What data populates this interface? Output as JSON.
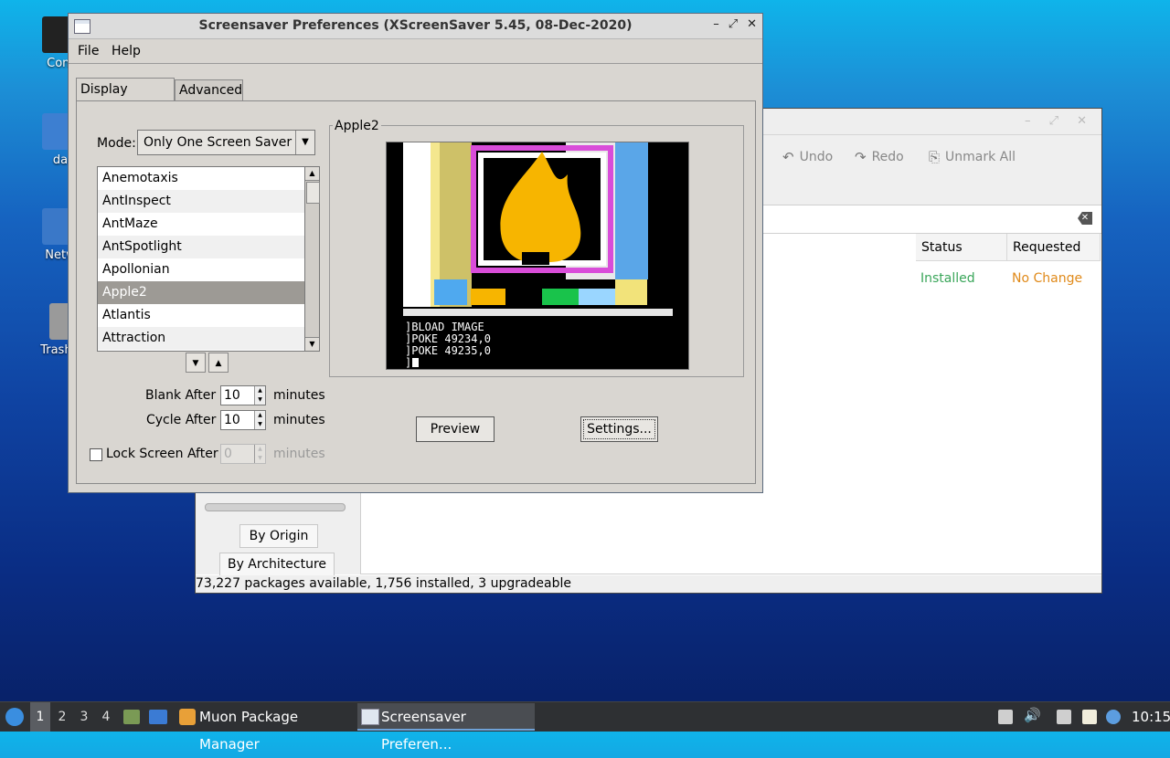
{
  "desktop": {
    "icons": [
      {
        "label": "Com"
      },
      {
        "label": "da"
      },
      {
        "label": "Netw"
      },
      {
        "label": "Trash ("
      }
    ]
  },
  "muon": {
    "toolbar": {
      "undo": "Undo",
      "redo": "Redo",
      "unmark_all": "Unmark All"
    },
    "columns": {
      "status": "Status",
      "requested": "Requested"
    },
    "row": {
      "status": "Installed",
      "requested": "No Change"
    },
    "sidebar": {
      "by_origin": "By Origin",
      "by_architecture": "By Architecture"
    },
    "statusbar": "73,227 packages available, 1,756 installed, 3 upgradeable",
    "colors": {
      "installed": "#3aa65a",
      "no_change": "#e08a1a"
    }
  },
  "ss": {
    "title": "Screensaver Preferences  (XScreenSaver 5.45, 08-Dec-2020)",
    "menu": {
      "file": "File",
      "help": "Help"
    },
    "tabs": {
      "display_modes": "Display Modes",
      "advanced": "Advanced"
    },
    "mode_label": "Mode:",
    "mode_value": "Only One Screen Saver",
    "list": [
      "Anemotaxis",
      "AntInspect",
      "AntMaze",
      "AntSpotlight",
      "Apollonian",
      "Apple2",
      "Atlantis",
      "Attraction"
    ],
    "selected": "Apple2",
    "blank_after": {
      "label": "Blank After",
      "value": "10",
      "unit": "minutes"
    },
    "cycle_after": {
      "label": "Cycle After",
      "value": "10",
      "unit": "minutes"
    },
    "lock_after": {
      "label": "Lock Screen After",
      "value": "0",
      "unit": "minutes"
    },
    "preview_title": "Apple2",
    "preview_text": [
      "]BLOAD IMAGE",
      "]POKE 49234,0",
      "]POKE 49235,0",
      "]"
    ],
    "buttons": {
      "preview": "Preview",
      "settings": "Settings..."
    }
  },
  "taskbar": {
    "workspaces": [
      "1",
      "2",
      "3",
      "4"
    ],
    "tasks": [
      {
        "label": "Muon Package Manager"
      },
      {
        "label": "Screensaver Preferen..."
      }
    ],
    "clock": "10:15"
  }
}
